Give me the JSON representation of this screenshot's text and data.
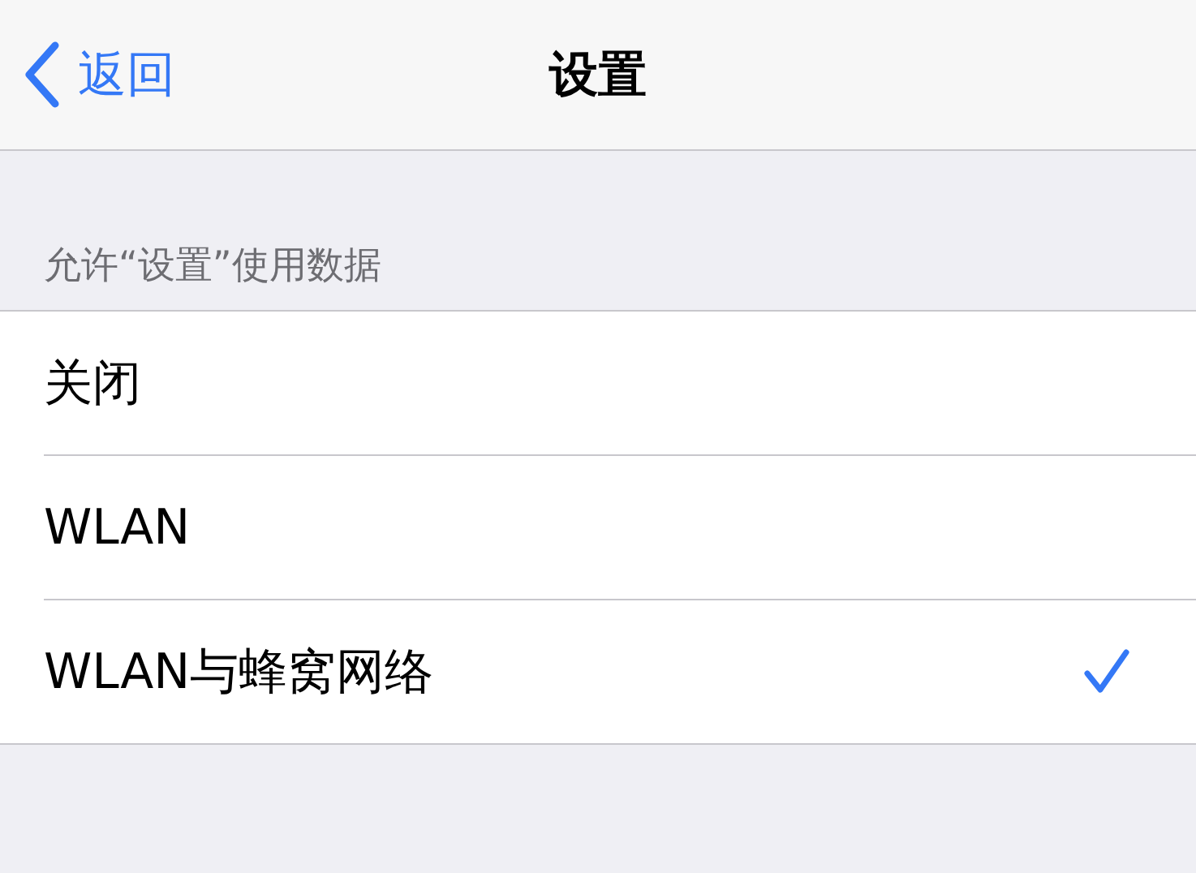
{
  "nav_bar": {
    "back_label": "返回",
    "title": "设置"
  },
  "section": {
    "header": "允许“设置”使用数据",
    "options": [
      {
        "label": "关闭",
        "selected": false
      },
      {
        "label": "WLAN",
        "selected": false
      },
      {
        "label": "WLAN与蜂窝网络",
        "selected": true
      }
    ]
  }
}
